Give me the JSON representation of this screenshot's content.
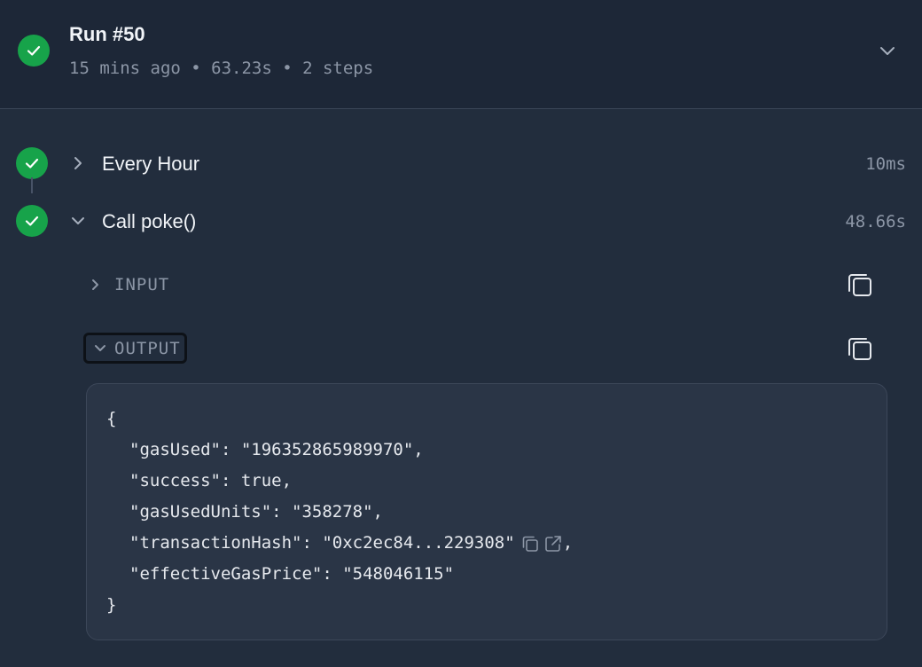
{
  "run": {
    "title": "Run #50",
    "meta": "15 mins ago • 63.23s • 2 steps"
  },
  "steps": [
    {
      "title": "Every Hour",
      "duration": "10ms"
    },
    {
      "title": "Call poke()",
      "duration": "48.66s"
    }
  ],
  "io": {
    "input_label": "INPUT",
    "output_label": "OUTPUT"
  },
  "output": {
    "open_brace": "{",
    "close_brace": "}",
    "lines": [
      "\"gasUsed\": \"196352865989970\",",
      "\"success\": true,",
      "\"gasUsedUnits\": \"358278\",",
      "\"effectiveGasPrice\": \"548046115\""
    ],
    "tx_key": "\"transactionHash\": ",
    "tx_value": "\"0xc2ec84...229308\"",
    "tx_suffix": ","
  },
  "icons": {
    "status": "check-circle-icon",
    "expand": "chevron-down-icon",
    "collapse": "chevron-right-icon",
    "copy": "copy-icon",
    "external": "external-link-icon"
  },
  "colors": {
    "success": "#17a34a",
    "background": "#222d3d",
    "header": "#1d2737",
    "muted_text": "#8c96a6"
  }
}
